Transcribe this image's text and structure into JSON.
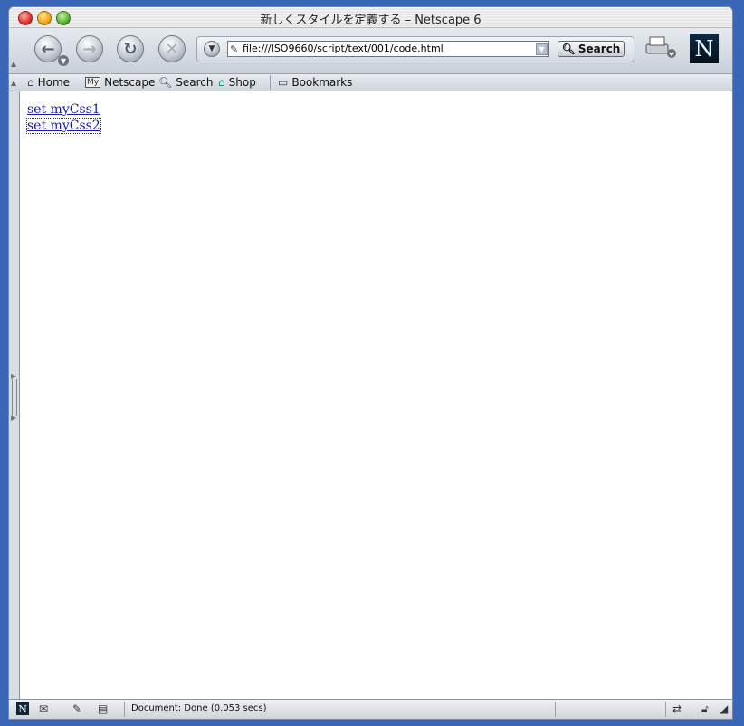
{
  "window": {
    "title": "新しくスタイルを定義する – Netscape 6"
  },
  "toolbar": {
    "url": "file:///ISO9660/script/text/001/code.html",
    "search_label": "Search"
  },
  "personal_toolbar": {
    "items": [
      {
        "label": "Home",
        "icon": "home-icon"
      },
      {
        "label": "Netscape",
        "icon": "my-netscape-icon",
        "badge": "My"
      },
      {
        "label": "Search",
        "icon": "search-icon"
      },
      {
        "label": "Shop",
        "icon": "shop-icon"
      },
      {
        "label": "Bookmarks",
        "icon": "bookmarks-folder-icon"
      }
    ]
  },
  "page": {
    "links": [
      {
        "text": "set myCss1"
      },
      {
        "text": "set myCss2"
      }
    ]
  },
  "statusbar": {
    "text": "Document: Done (0.053 secs)"
  },
  "colors": {
    "link": "#1a1aa6",
    "desktop": "#3a66b8",
    "chrome": "#d8dde4"
  }
}
